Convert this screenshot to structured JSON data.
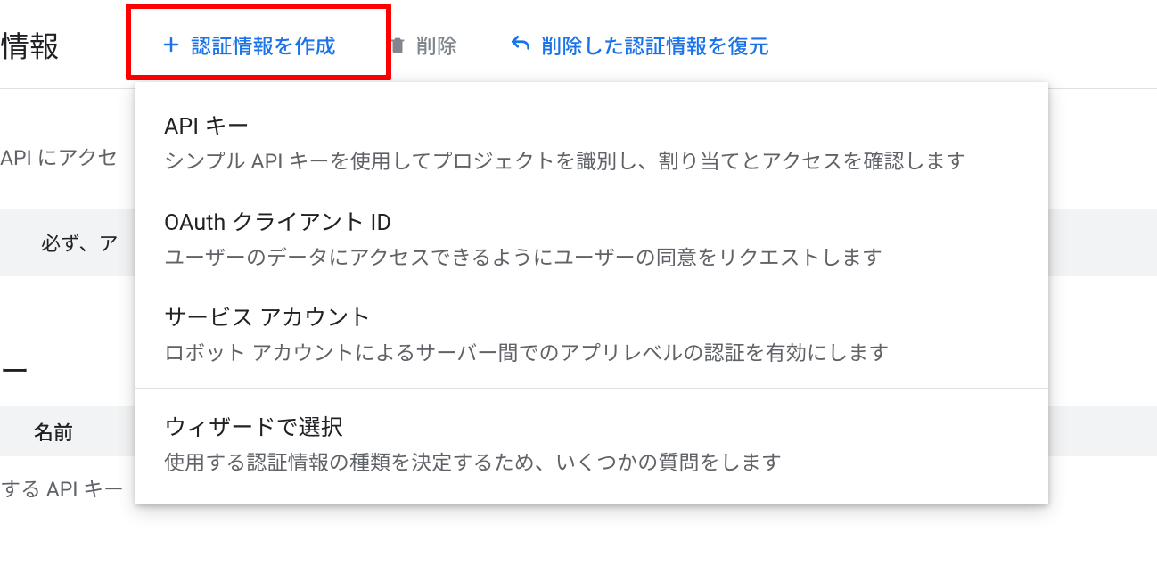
{
  "page_title": "情報",
  "toolbar": {
    "create_label": "認証情報を作成",
    "delete_label": "削除",
    "restore_label": "削除した認証情報を復元"
  },
  "dropdown": {
    "items": [
      {
        "title": "API キー",
        "desc": "シンプル API キーを使用してプロジェクトを識別し、割り当てとアクセスを確認します"
      },
      {
        "title": "OAuth クライアント ID",
        "desc": "ユーザーのデータにアクセスできるようにユーザーの同意をリクエストします"
      },
      {
        "title": "サービス アカウント",
        "desc": "ロボット アカウントによるサーバー間でのアプリレベルの認証を有効にします"
      },
      {
        "title": "ウィザードで選択",
        "desc": "使用する認証情報の種類を決定するため、いくつかの質問をします"
      }
    ]
  },
  "background": {
    "api_access_text": "API にアクセ",
    "warning_text": "必ず、ア",
    "key_section": "ー",
    "name_col": "名前",
    "api_key_row": "する API キー"
  }
}
